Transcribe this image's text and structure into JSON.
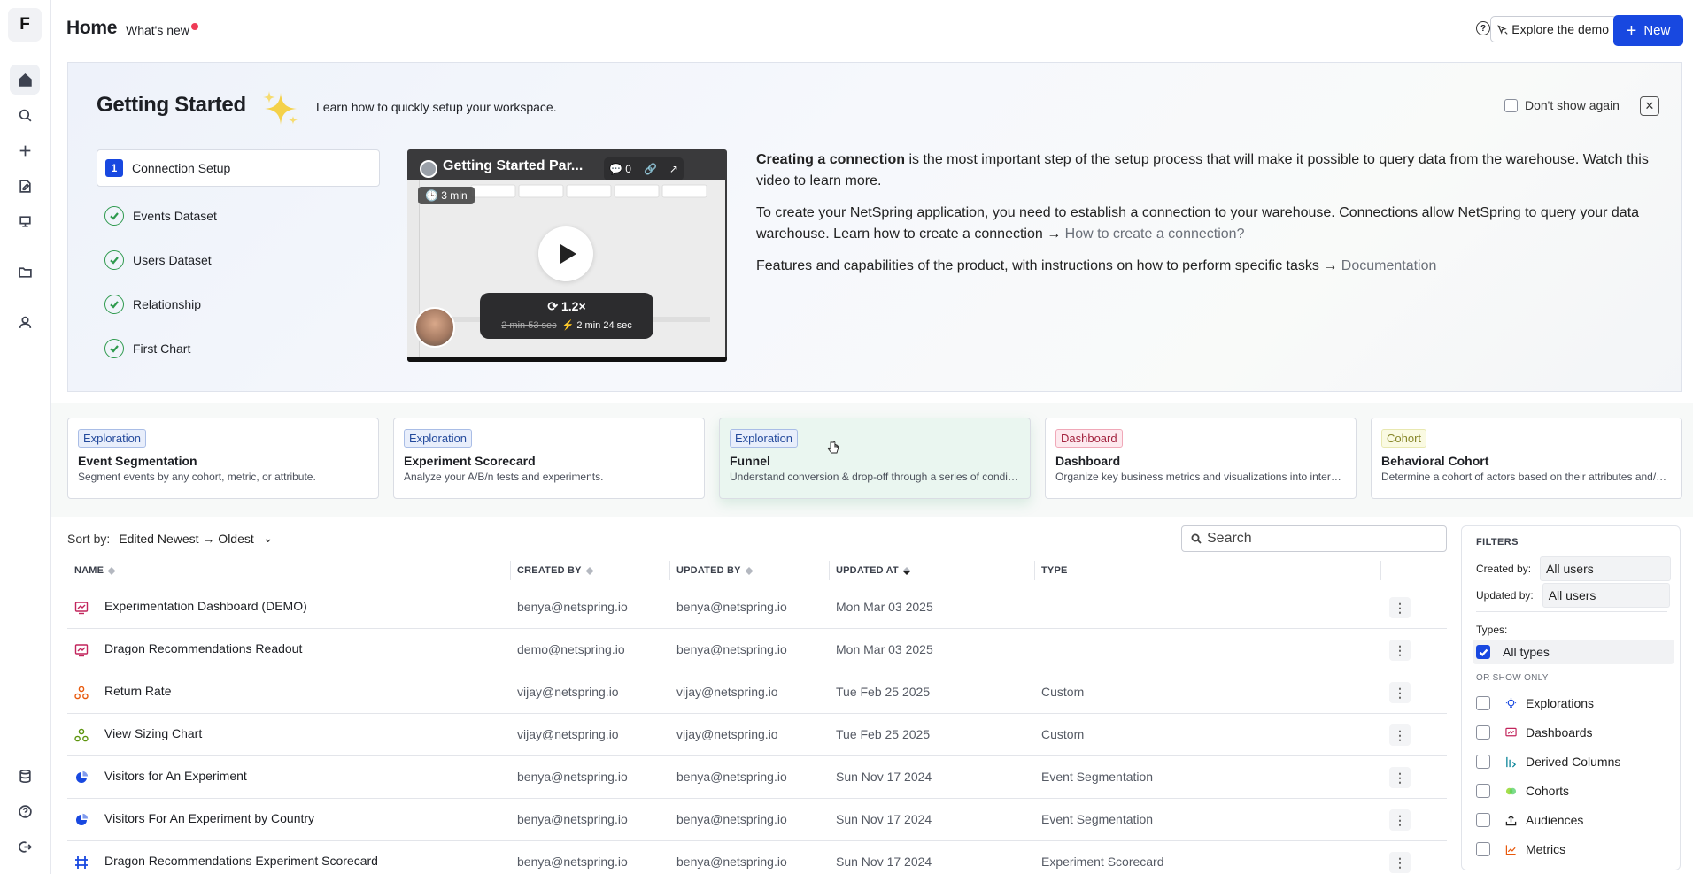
{
  "rail": {
    "logo": "F"
  },
  "header": {
    "title": "Home",
    "whats_new": "What's new",
    "help": "?",
    "explore_label": "Explore the demo",
    "new_label": "New"
  },
  "getting_started": {
    "title": "Getting Started",
    "subtitle": "Learn how to quickly setup your workspace.",
    "dont_show": "Don't show again",
    "steps": [
      {
        "num": "1",
        "label": "Connection Setup"
      },
      {
        "label": "Events Dataset"
      },
      {
        "label": "Users Dataset"
      },
      {
        "label": "Relationship"
      },
      {
        "label": "First Chart"
      }
    ],
    "video": {
      "title": "Getting Started Par...",
      "comments": "0",
      "duration": "3 min",
      "speed": "1.2×",
      "original_time": "2 min 53 sec",
      "fast_time": "⚡ 2 min 24 sec"
    },
    "para1_bold": "Creating a connection",
    "para1_rest": " is the most important step of the setup process that will make it possible to query data from the warehouse. Watch this video to learn more.",
    "para2": "To create your NetSpring application, you need to establish a connection to your warehouse. Connections allow NetSpring to query your data warehouse. Learn how to create a connection",
    "para2_link": "How to create a connection?",
    "para3": "Features and capabilities of the product, with instructions on how to perform specific tasks",
    "para3_link": "Documentation",
    "arrow": "→"
  },
  "templates": [
    {
      "tag": "Exploration",
      "title": "Event Segmentation",
      "desc": "Segment events by any cohort, metric, or attribute."
    },
    {
      "tag": "Exploration",
      "title": "Experiment Scorecard",
      "desc": "Analyze your A/B/n tests and experiments."
    },
    {
      "tag": "Exploration",
      "title": "Funnel",
      "desc": "Understand conversion & drop-off through a series of conditi..."
    },
    {
      "tag": "Dashboard",
      "title": "Dashboard",
      "desc": "Organize key business metrics and visualizations into interacti..."
    },
    {
      "tag": "Cohort",
      "title": "Behavioral Cohort",
      "desc": "Determine a cohort of actors based on their attributes and/or ..."
    }
  ],
  "list": {
    "sort_label": "Sort by:",
    "sort_value": "Edited Newest → Oldest",
    "search_placeholder": "Search",
    "columns": {
      "name": "NAME",
      "created_by": "CREATED BY",
      "updated_by": "UPDATED BY",
      "updated_at": "UPDATED AT",
      "type": "TYPE"
    },
    "rows": [
      {
        "icon": "dashboard",
        "name": "Experimentation Dashboard (DEMO)",
        "created_by": "benya@netspring.io",
        "updated_by": "benya@netspring.io",
        "updated_at": "Mon Mar 03 2025",
        "type": ""
      },
      {
        "icon": "dashboard",
        "name": "Dragon Recommendations Readout",
        "created_by": "demo@netspring.io",
        "updated_by": "benya@netspring.io",
        "updated_at": "Mon Mar 03 2025",
        "type": ""
      },
      {
        "icon": "custom-orange",
        "name": "Return Rate",
        "created_by": "vijay@netspring.io",
        "updated_by": "vijay@netspring.io",
        "updated_at": "Tue Feb 25 2025",
        "type": "Custom"
      },
      {
        "icon": "custom-green",
        "name": "View Sizing Chart",
        "created_by": "vijay@netspring.io",
        "updated_by": "vijay@netspring.io",
        "updated_at": "Tue Feb 25 2025",
        "type": "Custom"
      },
      {
        "icon": "segmentation",
        "name": "Visitors for An Experiment",
        "created_by": "benya@netspring.io",
        "updated_by": "benya@netspring.io",
        "updated_at": "Sun Nov 17 2024",
        "type": "Event Segmentation"
      },
      {
        "icon": "segmentation",
        "name": "Visitors For An Experiment by Country",
        "created_by": "benya@netspring.io",
        "updated_by": "benya@netspring.io",
        "updated_at": "Sun Nov 17 2024",
        "type": "Event Segmentation"
      },
      {
        "icon": "scorecard",
        "name": "Dragon Recommendations Experiment Scorecard",
        "created_by": "benya@netspring.io",
        "updated_by": "benya@netspring.io",
        "updated_at": "Sun Nov 17 2024",
        "type": "Experiment Scorecard"
      }
    ]
  },
  "filters": {
    "title": "FILTERS",
    "created_by_label": "Created by:",
    "created_by_value": "All users",
    "updated_by_label": "Updated by:",
    "updated_by_value": "All users",
    "types_label": "Types:",
    "all_types": "All types",
    "or_show_only": "OR SHOW ONLY",
    "options": [
      "Explorations",
      "Dashboards",
      "Derived Columns",
      "Cohorts",
      "Audiences",
      "Metrics"
    ]
  },
  "colors": {
    "primary": "#1848e0",
    "success": "#2f9a4e"
  }
}
